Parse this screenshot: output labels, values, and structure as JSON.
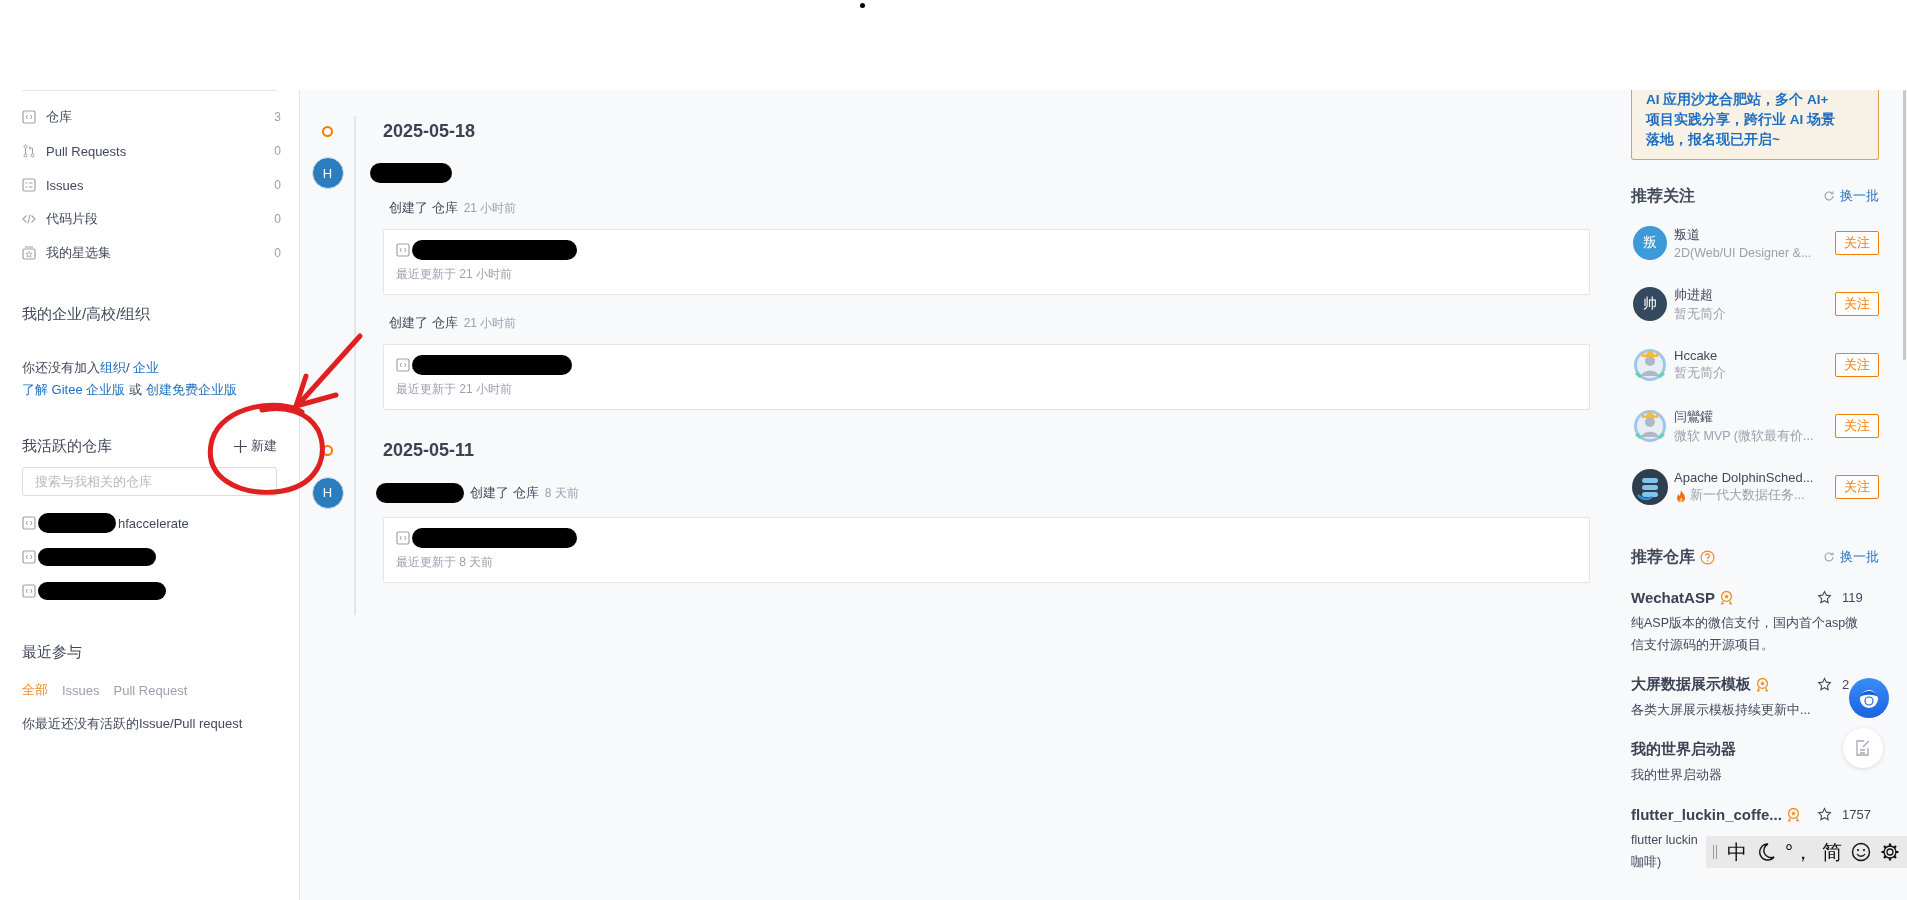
{
  "sidebar": {
    "nav_items": [
      {
        "label": "仓库",
        "count": "3"
      },
      {
        "label": "Pull Requests",
        "count": "0"
      },
      {
        "label": "Issues",
        "count": "0"
      },
      {
        "label": "代码片段",
        "count": "0"
      },
      {
        "label": "我的星选集",
        "count": "0"
      }
    ],
    "org_title": "我的企业/高校/组织",
    "org_notice": [
      [
        {
          "text": "你还没有加入",
          "link": false
        },
        {
          "text": "组织",
          "link": true
        },
        {
          "text": "/ ",
          "link": false
        },
        {
          "text": "企业",
          "link": true
        }
      ],
      [
        {
          "text": "了解 Gitee 企业版",
          "link": true
        },
        {
          "text": " 或 ",
          "link": false
        },
        {
          "text": "创建免费企业版",
          "link": true
        }
      ]
    ],
    "active_repos_title": "我活跃的仓库",
    "new_button": "新建",
    "search": {
      "placeholder": "搜索与我相关的仓库"
    },
    "repos": [
      {
        "kind": "partial",
        "name": "hfaccelerate"
      },
      {
        "kind": "hidden"
      },
      {
        "kind": "hidden"
      }
    ],
    "recent_title": "最近参与",
    "recent_tabs": [
      {
        "label": "全部",
        "selected": true
      },
      {
        "label": "Issues",
        "selected": false
      },
      {
        "label": "Pull Request",
        "selected": false
      }
    ],
    "recent_empty": "你最近还没有活跃的Issue/Pull request"
  },
  "timeline": [
    {
      "date": "2025-05-18",
      "kind": "separate",
      "avatar": "H",
      "events": [
        {
          "action": "创建了",
          "object": "仓库",
          "time": "21 小时前",
          "updated": "最近更新于 21 小时前"
        },
        {
          "action": "创建了",
          "object": "仓库",
          "time": "21 小时前",
          "updated": "最近更新于 21 小时前"
        }
      ]
    },
    {
      "date": "2025-05-11",
      "kind": "inline",
      "avatar": "H",
      "events": [
        {
          "action": "创建了",
          "object": "仓库",
          "time": "8 天前",
          "updated": "最近更新于 8 天前"
        }
      ]
    }
  ],
  "right": {
    "banner": [
      "AI 应用沙龙合肥站，多个 AI+",
      "项目实践分享，跨行业 AI 场景",
      "落地，报名现已开启~"
    ],
    "follow_title": "推荐关注",
    "follow_refresh": "换一批",
    "users": [
      {
        "kind": "letter",
        "avatar_text": "叛",
        "color": "#3d9ad8",
        "name": "叛道",
        "bio": "2D(Web/UI Designer &...",
        "fire": false,
        "button": "关注"
      },
      {
        "kind": "letter",
        "avatar_text": "帅",
        "color": "#34495e",
        "name": "帅进超",
        "bio": "暂无简介",
        "fire": false,
        "button": "关注"
      },
      {
        "kind": "picture",
        "name": "Hccake",
        "bio": "暂无简介",
        "fire": false,
        "button": "关注"
      },
      {
        "kind": "picture",
        "name": "闫鸞鑵",
        "bio": "微软 MVP (微软最有价...",
        "fire": false,
        "button": "关注"
      },
      {
        "kind": "logo",
        "name": "Apache DolphinSched...",
        "bio": "新一代大数据任务...",
        "fire": true,
        "button": "关注"
      }
    ],
    "repo_title": "推荐仓库",
    "repo_refresh": "换一批",
    "repos": [
      {
        "name": "WechatASP",
        "stars": "119",
        "desc": [
          "纯ASP版本的微信支付，国内首个asp微",
          "信支付源码的开源项目。"
        ]
      },
      {
        "name": "大屏数据展示模板",
        "stars": "2",
        "desc": [
          "各类大屏展示模板持续更新中..."
        ]
      },
      {
        "name": "我的世界启动器",
        "desc": [
          "我的世界启动器"
        ]
      },
      {
        "name": "flutter_luckin_coffe...",
        "stars": "1757",
        "desc": [
          "flutter luckin",
          "咖啡)"
        ]
      }
    ]
  },
  "ime_bar": {
    "items": [
      {
        "kind": "text",
        "text": "中"
      },
      {
        "kind": "moon"
      },
      {
        "kind": "text",
        "text": "°，"
      },
      {
        "kind": "text",
        "text": "简"
      },
      {
        "kind": "smiley"
      },
      {
        "kind": "gear"
      }
    ]
  }
}
